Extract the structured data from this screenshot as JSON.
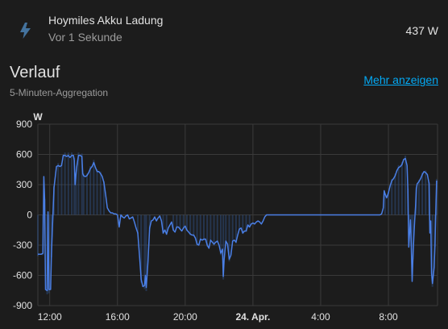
{
  "entity": {
    "name": "Hoymiles Akku Ladung",
    "secondary": "Vor 1 Sekunde",
    "state": "437 W",
    "icon": "lightning-bolt-icon"
  },
  "history": {
    "title": "Verlauf",
    "subtitle": "5-Minuten-Aggregation",
    "more_link": "Mehr anzeigen"
  },
  "colors": {
    "line": "#4a7fe6",
    "band": "#2e4a78",
    "grid": "#3a3a3a",
    "link": "#03a9f4"
  },
  "chart_data": {
    "type": "line",
    "ylabel": "W",
    "ylim": [
      -900,
      900
    ],
    "yticks": [
      "900",
      "600",
      "300",
      "0",
      "-300",
      "-600",
      "-900"
    ],
    "xlim": [
      11.3,
      34.9
    ],
    "xticks": [
      {
        "x": 12,
        "label": "12:00",
        "bold": false
      },
      {
        "x": 16,
        "label": "16:00",
        "bold": false
      },
      {
        "x": 20,
        "label": "20:00",
        "bold": false
      },
      {
        "x": 24,
        "label": "24. Apr.",
        "bold": true
      },
      {
        "x": 28,
        "label": "4:00",
        "bold": false
      },
      {
        "x": 32,
        "label": "8:00",
        "bold": false
      }
    ],
    "grid": true,
    "series": [
      {
        "values": [
          [
            11.3,
            -390
          ],
          [
            11.5,
            -390
          ],
          [
            11.6,
            -380
          ],
          [
            11.65,
            380
          ],
          [
            11.7,
            150
          ],
          [
            11.75,
            -740
          ],
          [
            11.85,
            -750
          ],
          [
            11.9,
            30
          ],
          [
            11.95,
            -740
          ],
          [
            12.05,
            -740
          ],
          [
            12.1,
            -400
          ],
          [
            12.15,
            -160
          ],
          [
            12.25,
            270
          ],
          [
            12.4,
            480
          ],
          [
            12.5,
            490
          ],
          [
            12.6,
            480
          ],
          [
            12.7,
            490
          ],
          [
            12.8,
            590
          ],
          [
            12.9,
            590
          ],
          [
            13.0,
            580
          ],
          [
            13.1,
            590
          ],
          [
            13.2,
            570
          ],
          [
            13.3,
            590
          ],
          [
            13.4,
            590
          ],
          [
            13.45,
            540
          ],
          [
            13.5,
            300
          ],
          [
            13.55,
            400
          ],
          [
            13.6,
            480
          ],
          [
            13.7,
            590
          ],
          [
            13.8,
            590
          ],
          [
            13.9,
            580
          ],
          [
            13.95,
            410
          ],
          [
            14.0,
            390
          ],
          [
            14.1,
            380
          ],
          [
            14.2,
            390
          ],
          [
            14.3,
            420
          ],
          [
            14.4,
            460
          ],
          [
            14.5,
            480
          ],
          [
            14.6,
            520
          ],
          [
            14.7,
            470
          ],
          [
            14.8,
            430
          ],
          [
            14.9,
            430
          ],
          [
            15.0,
            410
          ],
          [
            15.1,
            380
          ],
          [
            15.2,
            320
          ],
          [
            15.3,
            200
          ],
          [
            15.4,
            70
          ],
          [
            15.5,
            40
          ],
          [
            15.6,
            20
          ],
          [
            15.7,
            20
          ],
          [
            15.8,
            10
          ],
          [
            15.9,
            10
          ],
          [
            16.0,
            0
          ],
          [
            16.1,
            -120
          ],
          [
            16.2,
            0
          ],
          [
            16.3,
            -20
          ],
          [
            16.4,
            -30
          ],
          [
            16.5,
            -10
          ],
          [
            16.6,
            0
          ],
          [
            16.7,
            -40
          ],
          [
            16.8,
            -30
          ],
          [
            16.9,
            -20
          ],
          [
            17.0,
            -70
          ],
          [
            17.1,
            -130
          ],
          [
            17.2,
            -180
          ],
          [
            17.3,
            -400
          ],
          [
            17.4,
            -640
          ],
          [
            17.5,
            -710
          ],
          [
            17.6,
            -700
          ],
          [
            17.65,
            -600
          ],
          [
            17.7,
            -720
          ],
          [
            17.8,
            -470
          ],
          [
            17.9,
            -130
          ],
          [
            18.0,
            -60
          ],
          [
            18.1,
            -50
          ],
          [
            18.2,
            -20
          ],
          [
            18.3,
            -60
          ],
          [
            18.4,
            -30
          ],
          [
            18.5,
            -10
          ],
          [
            18.6,
            -60
          ],
          [
            18.7,
            -180
          ],
          [
            18.8,
            -150
          ],
          [
            18.9,
            -190
          ],
          [
            19.0,
            -130
          ],
          [
            19.1,
            -100
          ],
          [
            19.2,
            -70
          ],
          [
            19.3,
            -150
          ],
          [
            19.4,
            -170
          ],
          [
            19.5,
            -120
          ],
          [
            19.6,
            -120
          ],
          [
            19.7,
            -140
          ],
          [
            19.8,
            -160
          ],
          [
            19.9,
            -130
          ],
          [
            20.0,
            -110
          ],
          [
            20.1,
            -150
          ],
          [
            20.2,
            -170
          ],
          [
            20.3,
            -190
          ],
          [
            20.4,
            -200
          ],
          [
            20.5,
            -200
          ],
          [
            20.6,
            -230
          ],
          [
            20.7,
            -290
          ],
          [
            20.8,
            -300
          ],
          [
            20.9,
            -240
          ],
          [
            21.0,
            -250
          ],
          [
            21.1,
            -240
          ],
          [
            21.2,
            -240
          ],
          [
            21.3,
            -300
          ],
          [
            21.4,
            -330
          ],
          [
            21.5,
            -250
          ],
          [
            21.6,
            -270
          ],
          [
            21.7,
            -290
          ],
          [
            21.8,
            -270
          ],
          [
            21.9,
            -260
          ],
          [
            22.0,
            -300
          ],
          [
            22.1,
            -380
          ],
          [
            22.2,
            -340
          ],
          [
            22.25,
            -610
          ],
          [
            22.3,
            -440
          ],
          [
            22.4,
            -260
          ],
          [
            22.5,
            -290
          ],
          [
            22.6,
            -440
          ],
          [
            22.7,
            -400
          ],
          [
            22.8,
            -260
          ],
          [
            22.9,
            -250
          ],
          [
            23.0,
            -270
          ],
          [
            23.1,
            -200
          ],
          [
            23.2,
            -140
          ],
          [
            23.3,
            -130
          ],
          [
            23.4,
            -180
          ],
          [
            23.5,
            -160
          ],
          [
            23.6,
            -160
          ],
          [
            23.7,
            -100
          ],
          [
            23.8,
            -120
          ],
          [
            23.9,
            -90
          ],
          [
            24.0,
            -80
          ],
          [
            24.1,
            -90
          ],
          [
            24.2,
            -70
          ],
          [
            24.3,
            -60
          ],
          [
            24.4,
            -70
          ],
          [
            24.5,
            -90
          ],
          [
            24.6,
            -60
          ],
          [
            24.7,
            -20
          ],
          [
            24.8,
            0
          ],
          [
            25.0,
            0
          ],
          [
            26.0,
            0
          ],
          [
            27.0,
            0
          ],
          [
            28.0,
            0
          ],
          [
            29.0,
            0
          ],
          [
            30.0,
            0
          ],
          [
            31.0,
            0
          ],
          [
            31.5,
            0
          ],
          [
            31.6,
            10
          ],
          [
            31.7,
            70
          ],
          [
            31.75,
            240
          ],
          [
            31.8,
            210
          ],
          [
            31.9,
            170
          ],
          [
            32.0,
            220
          ],
          [
            32.1,
            290
          ],
          [
            32.2,
            340
          ],
          [
            32.3,
            360
          ],
          [
            32.4,
            390
          ],
          [
            32.5,
            440
          ],
          [
            32.6,
            470
          ],
          [
            32.7,
            480
          ],
          [
            32.8,
            500
          ],
          [
            32.9,
            550
          ],
          [
            33.0,
            560
          ],
          [
            33.1,
            490
          ],
          [
            33.15,
            250
          ],
          [
            33.2,
            -320
          ],
          [
            33.25,
            -180
          ],
          [
            33.3,
            -50
          ],
          [
            33.35,
            -300
          ],
          [
            33.4,
            -660
          ],
          [
            33.45,
            -420
          ],
          [
            33.5,
            -220
          ],
          [
            33.55,
            -60
          ],
          [
            33.6,
            80
          ],
          [
            33.65,
            260
          ],
          [
            33.7,
            310
          ],
          [
            33.8,
            330
          ],
          [
            33.9,
            360
          ],
          [
            34.0,
            400
          ],
          [
            34.1,
            430
          ],
          [
            34.2,
            420
          ],
          [
            34.3,
            400
          ],
          [
            34.4,
            310
          ],
          [
            34.45,
            -180
          ],
          [
            34.5,
            -60
          ],
          [
            34.55,
            -580
          ],
          [
            34.6,
            -680
          ],
          [
            34.7,
            -520
          ],
          [
            34.75,
            -300
          ],
          [
            34.8,
            50
          ],
          [
            34.85,
            340
          ]
        ]
      }
    ]
  }
}
